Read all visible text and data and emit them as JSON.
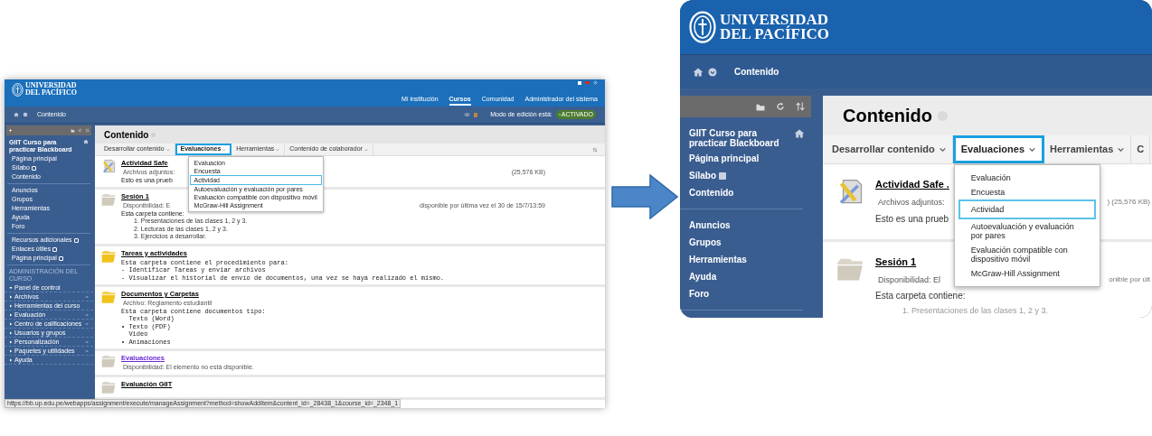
{
  "screens": [
    {
      "kind": "full",
      "logo": [
        "UNIVERSIDAD",
        "DEL PACÍFICO"
      ],
      "nav": [
        {
          "label": "Mi institución",
          "selected": false
        },
        {
          "label": "Cursos",
          "selected": true
        },
        {
          "label": "Comunidad",
          "selected": false
        },
        {
          "label": "Administrador del sistema",
          "selected": false
        }
      ],
      "breadcrumb": "Contenido",
      "edit_mode": {
        "label": "Modo de edición está:",
        "value": "ACTIVADO",
        "on": true
      },
      "sidebar": {
        "title": "GIIT Curso para practicar Blackboard",
        "sections": [
          [
            {
              "label": "Página principal",
              "badge": false
            },
            {
              "label": "Sílabo",
              "badge": true
            },
            {
              "label": "Contenido",
              "badge": false
            }
          ],
          [
            {
              "label": "Anuncios",
              "badge": false
            },
            {
              "label": "Grupos",
              "badge": false
            },
            {
              "label": "Herramientas",
              "badge": false
            },
            {
              "label": "Ayuda",
              "badge": false
            },
            {
              "label": "Foro",
              "badge": false
            }
          ],
          [
            {
              "label": "Recursos adicionales",
              "badge": true
            },
            {
              "label": "Enlaces útiles",
              "badge": true
            },
            {
              "label": "Página principal",
              "badge": true
            }
          ]
        ],
        "admin": {
          "heading": "ADMINISTRACIÓN DEL CURSO",
          "items": [
            {
              "label": "Panel de control",
              "expanded": true,
              "submenu": false
            },
            {
              "label": "Archivos",
              "expanded": false,
              "submenu": true
            },
            {
              "label": "Herramientas del curso",
              "expanded": false,
              "submenu": false
            },
            {
              "label": "Evaluación",
              "expanded": false,
              "submenu": true
            },
            {
              "label": "Centro de calificaciones",
              "expanded": false,
              "submenu": true
            },
            {
              "label": "Usuarios y grupos",
              "expanded": false,
              "submenu": false
            },
            {
              "label": "Personalización",
              "expanded": false,
              "submenu": true
            },
            {
              "label": "Paquetes y utilidades",
              "expanded": false,
              "submenu": true
            },
            {
              "label": "Ayuda",
              "expanded": false,
              "submenu": false
            }
          ]
        }
      },
      "content": {
        "title": "Contenido",
        "toolbar": [
          {
            "label": "Desarrollar contenido",
            "selected": false,
            "caret": true
          },
          {
            "label": "Evaluaciones",
            "selected": true,
            "caret": true
          },
          {
            "label": "Herramientas",
            "selected": false,
            "caret": true
          },
          {
            "label": "Contenido de colaborador",
            "selected": false,
            "caret": true
          }
        ],
        "menu": [
          {
            "label": "Evaluación",
            "selected": false
          },
          {
            "label": "Encuesta",
            "selected": false
          },
          {
            "label": "Actividad",
            "selected": true
          },
          {
            "label": "Autoevaluación y evaluación por pares",
            "selected": false
          },
          {
            "label": "Evaluación compatible con dispositivo móvil",
            "selected": false
          },
          {
            "label": "McGraw-Hill Assignment",
            "selected": false
          }
        ],
        "items": [
          {
            "kind": "file",
            "title": "Actividad Safe",
            "visited": false,
            "lines": [
              {
                "kind": "meta",
                "text": "Archivos adjuntos:",
                "trail": "(25,576 KB)"
              },
              {
                "kind": "text",
                "text": "Esto es una prueb"
              }
            ]
          },
          {
            "kind": "folder",
            "color": "#cfcabb",
            "title": "Sesión 1",
            "visited": false,
            "lines": [
              {
                "kind": "meta",
                "text": "Disponibilidad:  E",
                "trail": "disponible por última vez el 30 de 15/7/13:59"
              },
              {
                "kind": "text",
                "text": "Esta carpeta contiene:"
              },
              {
                "kind": "list",
                "text": "1. Presentaciones de las clases 1, 2 y 3."
              },
              {
                "kind": "list",
                "text": "2. Lecturas de las clases 1, 2 y 3."
              },
              {
                "kind": "list",
                "text": "3. Ejercicios a desarrollar."
              }
            ]
          },
          {
            "kind": "folder",
            "color": "#f2c21b",
            "title": "Tareas y actividades",
            "visited": false,
            "lines": [
              {
                "kind": "mono",
                "text": "Esta carpeta contiene el procedimiento para:"
              },
              {
                "kind": "mono",
                "text": "- Identificar Tareas y enviar archivos"
              },
              {
                "kind": "mono",
                "text": "- Visualizar el historial de envío de documentos, una vez se haya realizado el mismo."
              }
            ]
          },
          {
            "kind": "folder",
            "color": "#f2c21b",
            "title": "Documentos y Carpetas",
            "visited": false,
            "lines": [
              {
                "kind": "meta",
                "text": "Archivo: Reglamento estudiantil"
              },
              {
                "kind": "mono",
                "text": "Esta carpeta contiene documentos tipo:"
              },
              {
                "kind": "mono",
                "text": "  Texto (Word)"
              },
              {
                "kind": "mono",
                "text": "• Texto (PDF)"
              },
              {
                "kind": "mono",
                "text": "  Video"
              },
              {
                "kind": "mono",
                "text": "• Animaciones"
              }
            ]
          },
          {
            "kind": "folder",
            "color": "#cfcabb",
            "title": "Evaluaciones",
            "visited": true,
            "lines": [
              {
                "kind": "meta",
                "text": "Disponibilidad:  El elemento no está disponible."
              }
            ]
          },
          {
            "kind": "folder",
            "color": "#cfcabb",
            "title": "Evaluación GIIT",
            "visited": false
          }
        ]
      },
      "status_url": "https://bb.up.edu.pe/webapps/assignment/execute/manageAssignment?method=showAddItem&content_id=_28438_1&course_id=_2348_1"
    },
    {
      "kind": "zoom",
      "logo": [
        "UNIVERSIDAD",
        "DEL PACÍFICO"
      ],
      "breadcrumb": "Contenido",
      "sidebar": {
        "title": "GIIT Curso para practicar Blackboard",
        "sections": [
          [
            {
              "label": "Página principal",
              "badge": false
            },
            {
              "label": "Sílabo",
              "badge": true
            },
            {
              "label": "Contenido",
              "badge": false
            }
          ],
          [
            {
              "label": "Anuncios",
              "badge": false
            },
            {
              "label": "Grupos",
              "badge": false
            },
            {
              "label": "Herramientas",
              "badge": false
            },
            {
              "label": "Ayuda",
              "badge": false
            },
            {
              "label": "Foro",
              "badge": false
            }
          ]
        ]
      },
      "content": {
        "title": "Contenido",
        "toolbar": [
          {
            "label": "Desarrollar contenido",
            "selected": false,
            "caret": true
          },
          {
            "label": "Evaluaciones",
            "selected": true,
            "caret": true
          },
          {
            "label": "Herramientas",
            "selected": false,
            "caret": true
          },
          {
            "label": "C",
            "selected": false,
            "caret": false
          }
        ],
        "menu": [
          {
            "label": "Evaluación",
            "selected": false
          },
          {
            "label": "Encuesta",
            "selected": false
          },
          {
            "label": "Actividad",
            "selected": true
          },
          {
            "label": "Autoevaluación y evaluación por pares",
            "selected": false
          },
          {
            "label": "Evaluación compatible con dispositivo móvil",
            "selected": false
          },
          {
            "label": "McGraw-Hill Assignment",
            "selected": false
          }
        ],
        "items": [
          {
            "kind": "file",
            "title": "Actividad Safe .",
            "visited": false,
            "lines": [
              {
                "kind": "meta",
                "text": "Archivos adjuntos:",
                "trail": ") (25,576 KB)"
              },
              {
                "kind": "text",
                "text": "Esto es una prueb"
              }
            ]
          },
          {
            "kind": "folder",
            "color": "#cfcabb",
            "title": "Sesión 1",
            "visited": false,
            "lines": [
              {
                "kind": "meta",
                "text": "Disponibilidad:  El",
                "trail": "onible por últ"
              },
              {
                "kind": "text",
                "text": "Esta carpeta contiene:"
              },
              {
                "kind": "faded",
                "text": "1. Presentaciones de las clases 1, 2 y 3."
              }
            ]
          }
        ]
      }
    }
  ]
}
